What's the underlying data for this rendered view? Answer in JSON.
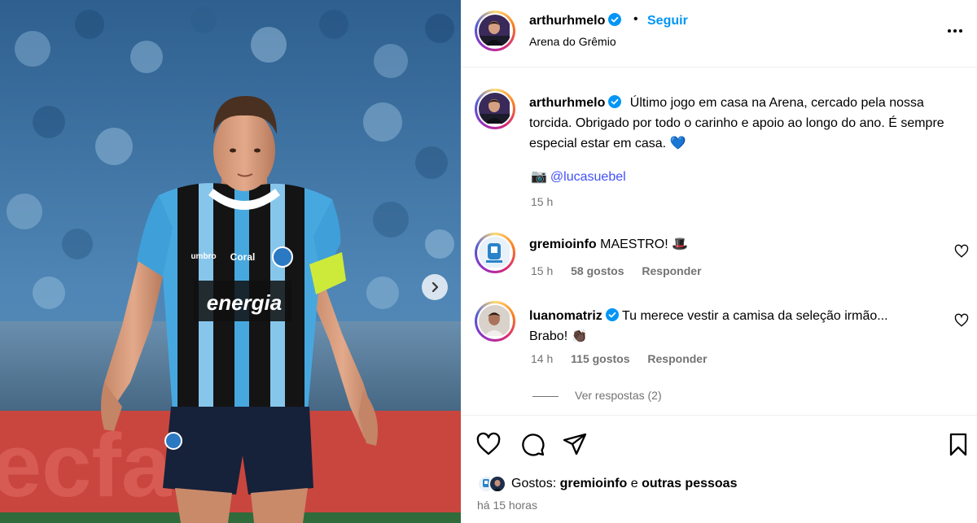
{
  "post": {
    "author": "arthurhmelo",
    "follow_dot": "•",
    "follow_label": "Seguir",
    "location": "Arena do Grêmio",
    "caption": "Último jogo em casa na Arena, cercado pela nossa torcida. Obrigado por todo o carinho e apoio ao longo do ano. É sempre especial estar em casa. 💙",
    "credit_emoji": "📷",
    "credit_mention": "@lucasuebel",
    "caption_time": "15 h"
  },
  "photo": {
    "jersey_sponsor": "energia",
    "jersey_brand": "Coral",
    "jersey_maker": "umbro"
  },
  "comments": [
    {
      "username": "gremioinfo",
      "text": "MAESTRO! 🎩",
      "time": "15 h",
      "likes": "58 gostos",
      "reply": "Responder",
      "avatar_icon": "gremioinfo-logo-icon"
    },
    {
      "username": "luanomatriz",
      "verified": true,
      "text": "Tu merece vestir a camisa da seleção irmão... Brabo! 👏🏿",
      "time": "14 h",
      "likes": "115 gostos",
      "reply": "Responder",
      "view_replies": "Ver respostas (2)"
    }
  ],
  "footer": {
    "likes_prefix": "Gostos:",
    "likes_user": "gremioinfo",
    "likes_and": "e",
    "likes_others": "outras pessoas",
    "time_ago": "há 15 horas"
  },
  "icons": {
    "like": "heart-icon",
    "comment": "comment-icon",
    "share": "share-icon",
    "save": "bookmark-icon",
    "more": "more-icon",
    "next": "chevron-right-icon"
  },
  "colors": {
    "link_blue": "#0095f6",
    "mention_blue": "#4150f7",
    "verified_blue": "#0095f6",
    "meta_gray": "#737373"
  }
}
